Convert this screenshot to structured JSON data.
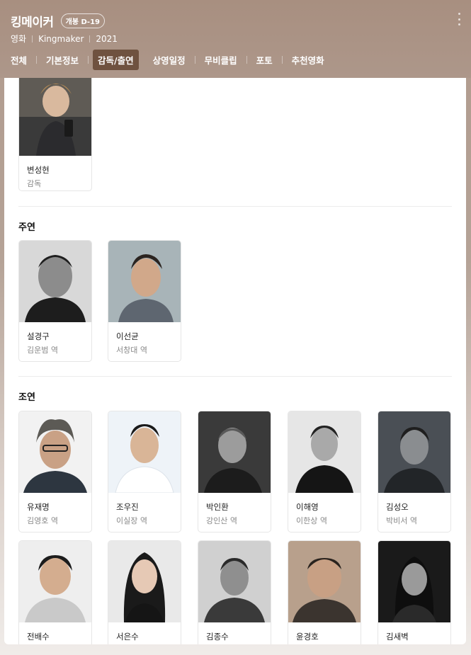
{
  "header": {
    "title": "킹메이커",
    "badge": "개봉 D-19",
    "meta": [
      "영화",
      "Kingmaker",
      "2021"
    ],
    "tabs": [
      {
        "label": "전체",
        "active": false
      },
      {
        "label": "기본정보",
        "active": false
      },
      {
        "label": "감독/출연",
        "active": true
      },
      {
        "label": "상영일정",
        "active": false
      },
      {
        "label": "무비클립",
        "active": false
      },
      {
        "label": "포토",
        "active": false
      },
      {
        "label": "추천영화",
        "active": false
      }
    ]
  },
  "director": {
    "name": "변성현",
    "role": "감독"
  },
  "sections": {
    "lead": "주연",
    "support": "조연"
  },
  "lead_cast": [
    {
      "name": "설경구",
      "role": "김운범 역"
    },
    {
      "name": "이선균",
      "role": "서창대 역"
    }
  ],
  "support_cast": [
    {
      "name": "유재명",
      "role": "김영호 역"
    },
    {
      "name": "조우진",
      "role": "이실장 역"
    },
    {
      "name": "박인환",
      "role": "강인산 역"
    },
    {
      "name": "이해영",
      "role": "이한상 역"
    },
    {
      "name": "김성오",
      "role": "박비서 역"
    },
    {
      "name": "전배수",
      "role": ""
    },
    {
      "name": "서은수",
      "role": ""
    },
    {
      "name": "김종수",
      "role": ""
    },
    {
      "name": "윤경호",
      "role": ""
    },
    {
      "name": "김새벽",
      "role": ""
    }
  ],
  "colors": {
    "header_bg": "#ad978a",
    "active_tab": "#6f5240"
  }
}
